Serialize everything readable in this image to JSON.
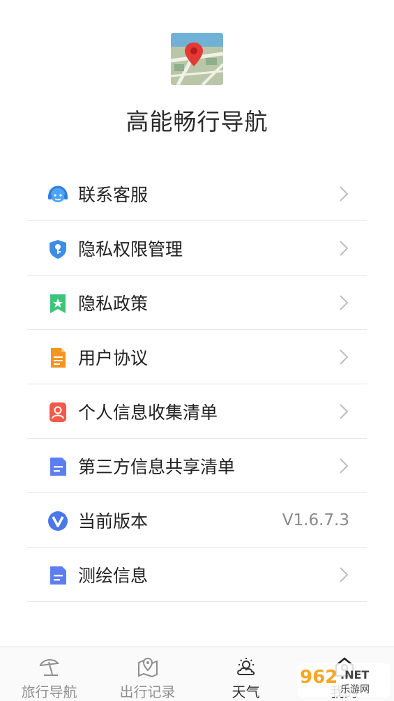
{
  "app": {
    "title": "高能畅行导航"
  },
  "menu": {
    "items": [
      {
        "label": "联系客服",
        "icon": "headset-icon"
      },
      {
        "label": "隐私权限管理",
        "icon": "shield-key-icon"
      },
      {
        "label": "隐私政策",
        "icon": "bookmark-star-icon"
      },
      {
        "label": "用户协议",
        "icon": "document-icon"
      },
      {
        "label": "个人信息收集清单",
        "icon": "person-card-icon"
      },
      {
        "label": "第三方信息共享清单",
        "icon": "list-document-icon"
      },
      {
        "label": "当前版本",
        "icon": "v-badge-icon",
        "value": "V1.6.7.3"
      },
      {
        "label": "测绘信息",
        "icon": "list-document-icon"
      }
    ]
  },
  "tabbar": {
    "tabs": [
      {
        "label": "旅行导航",
        "icon": "beach-umbrella-icon"
      },
      {
        "label": "出行记录",
        "icon": "map-pin-icon"
      },
      {
        "label": "天气",
        "icon": "weather-icon"
      },
      {
        "label": "我的",
        "icon": "home-icon"
      }
    ]
  },
  "watermark": {
    "text": "962.NET 乐游网"
  },
  "colors": {
    "accent": "#3b7ddd",
    "pin": "#e53935"
  }
}
